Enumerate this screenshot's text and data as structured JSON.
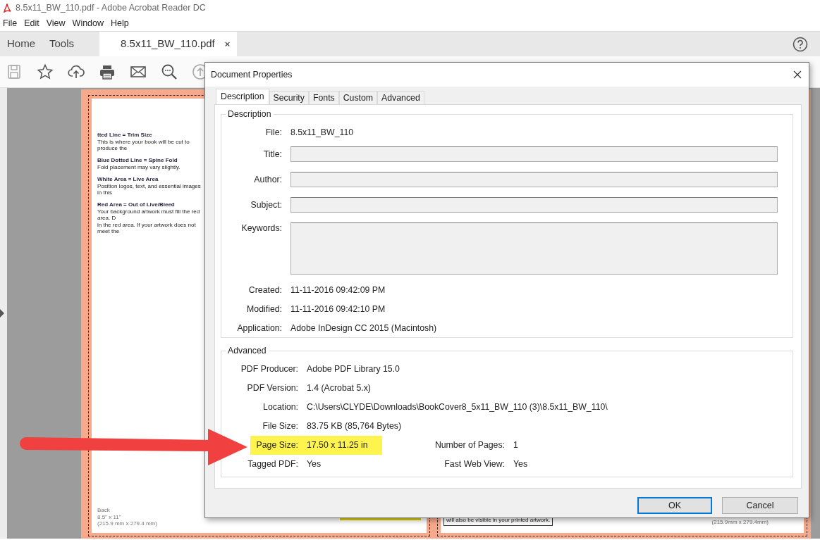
{
  "window": {
    "title": "8.5x11_BW_110.pdf - Adobe Acrobat Reader DC"
  },
  "menu": [
    "File",
    "Edit",
    "View",
    "Window",
    "Help"
  ],
  "nav_tabs": [
    {
      "label": "Home",
      "selected": false
    },
    {
      "label": "Tools",
      "selected": false
    },
    {
      "label": "8.5x11_BW_110.pdf",
      "selected": true,
      "close": "×"
    }
  ],
  "toolbar": [
    {
      "kind": "save",
      "disabled": true
    },
    {
      "kind": "star",
      "disabled": false
    },
    {
      "kind": "upload",
      "disabled": false
    },
    {
      "kind": "print",
      "disabled": false
    },
    {
      "kind": "mail",
      "disabled": false
    },
    {
      "kind": "zoom",
      "disabled": false
    },
    {
      "kind": "up",
      "disabled": true
    }
  ],
  "document": {
    "notes": [
      {
        "heading": "tted Line = Trim Size",
        "lines": [
          "This is where your book will be cut to produce the"
        ]
      },
      {
        "heading": "Blue Dotted Line = Spine Fold",
        "lines": [
          "Fold placement may vary slightly."
        ]
      },
      {
        "heading": "White Area = Live Area",
        "lines": [
          "Position logos, text, and essential images in this"
        ]
      },
      {
        "heading": "Red Area = Out of Live/Bleed",
        "lines": [
          "Your background artwork must fill the red area. D",
          "in the red area. If your artwork does not meet the"
        ]
      }
    ],
    "back_label": [
      "Back",
      "8.5\" x 11\"",
      "(215.9 mm x 279.4 mm)"
    ],
    "right_page": {
      "notice": "will also be visible in your printed artwork.",
      "size": "(215.9mm x 279.4mm)"
    }
  },
  "dialog": {
    "title": "Document Properties",
    "tabs": [
      {
        "label": "Description",
        "selected": true
      },
      {
        "label": "Security",
        "selected": false
      },
      {
        "label": "Fonts",
        "selected": false
      },
      {
        "label": "Custom",
        "selected": false
      },
      {
        "label": "Advanced",
        "selected": false
      }
    ],
    "description": {
      "legend": "Description",
      "fields": [
        {
          "kind": "text",
          "label": "File:",
          "value": "8.5x11_BW_110"
        },
        {
          "kind": "input",
          "label": "Title:"
        },
        {
          "kind": "input",
          "label": "Author:"
        },
        {
          "kind": "input",
          "label": "Subject:"
        },
        {
          "kind": "area",
          "label": "Keywords:"
        },
        {
          "kind": "text",
          "label": "Created:",
          "value": "11-11-2016 09:42:09 PM"
        },
        {
          "kind": "text",
          "label": "Modified:",
          "value": "11-11-2016 09:42:10 PM"
        },
        {
          "kind": "text",
          "label": "Application:",
          "value": "Adobe InDesign CC 2015 (Macintosh)"
        }
      ]
    },
    "advanced": {
      "legend": "Advanced",
      "rows": [
        [
          {
            "label": "PDF Producer:",
            "value": "Adobe PDF Library 15.0",
            "highlighted": false
          }
        ],
        [
          {
            "label": "PDF Version:",
            "value": "1.4 (Acrobat 5.x)",
            "highlighted": false
          }
        ],
        [
          {
            "label": "Location:",
            "value": "C:\\Users\\CLYDE\\Downloads\\BookCover8_5x11_BW_110 (3)\\8.5x11_BW_110\\",
            "highlighted": false
          }
        ],
        [
          {
            "label": "File Size:",
            "value": "83.75 KB (85,764 Bytes)",
            "highlighted": false
          }
        ],
        [
          {
            "label": "Page Size:",
            "value": "17.50 x 11.25 in",
            "highlighted": true
          },
          {
            "label": "Number of Pages:",
            "value": "1",
            "highlighted": false
          }
        ],
        [
          {
            "label": "Tagged PDF:",
            "value": "Yes",
            "highlighted": false
          },
          {
            "label": "Fast Web View:",
            "value": "Yes",
            "highlighted": false
          }
        ]
      ]
    },
    "buttons": [
      {
        "label": "OK",
        "default": true
      },
      {
        "label": "Cancel",
        "default": false
      }
    ]
  }
}
